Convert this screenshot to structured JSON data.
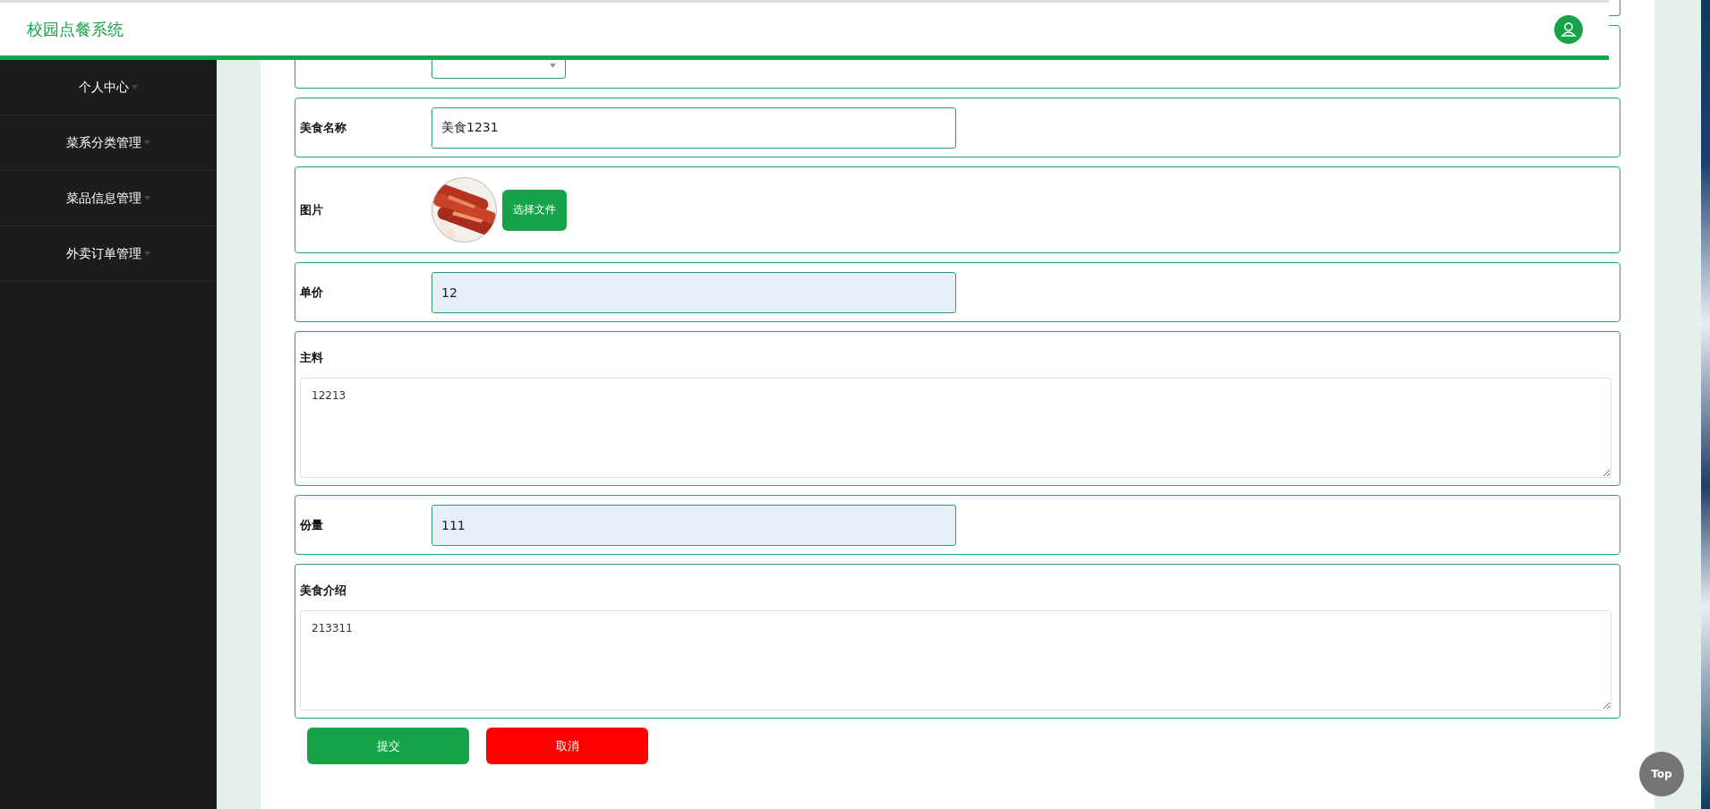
{
  "header": {
    "title": "校园点餐系统"
  },
  "sidebar": {
    "items": [
      {
        "label": "个人中心"
      },
      {
        "label": "菜系分类管理"
      },
      {
        "label": "菜品信息管理"
      },
      {
        "label": "外卖订单管理"
      }
    ]
  },
  "form": {
    "rows": [
      {
        "kind": "select"
      },
      {
        "kind": "input",
        "label": "美食名称",
        "value": "美食1231",
        "highlighted": false
      },
      {
        "label": "图片",
        "button": "选择文件"
      },
      {
        "kind": "input",
        "label": "单价",
        "value": "12",
        "highlighted": true
      },
      {
        "kind": "textarea",
        "label": "主料",
        "value": "12213"
      },
      {
        "kind": "input",
        "label": "份量",
        "value": "111",
        "highlighted": true
      },
      {
        "kind": "textarea",
        "label": "美食介绍",
        "value": "213311"
      }
    ],
    "buttons": [
      {
        "label": "提交",
        "kind": "primary"
      },
      {
        "label": "取消",
        "kind": "danger"
      }
    ]
  },
  "back_to_top": "Top"
}
